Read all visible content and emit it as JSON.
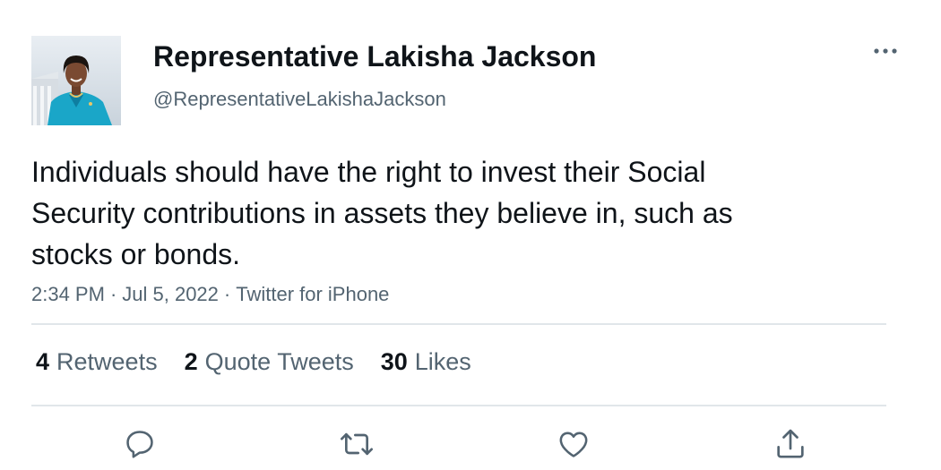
{
  "author": {
    "display_name": "Representative Lakisha Jackson",
    "handle": "@RepresentativeLakishaJackson",
    "avatar_icon": "profile-photo"
  },
  "tweet": {
    "text": "Individuals should have the right to invest their Social Security contributions in assets they believe in, such as stocks or bonds.",
    "time": "2:34 PM",
    "date": "Jul 5, 2022",
    "source": "Twitter for iPhone",
    "separator": "·"
  },
  "stats": {
    "retweets_count": "4",
    "retweets_label": "Retweets",
    "quotes_count": "2",
    "quotes_label": "Quote Tweets",
    "likes_count": "30",
    "likes_label": "Likes"
  },
  "actions": {
    "reply_icon": "reply-icon",
    "retweet_icon": "retweet-icon",
    "like_icon": "heart-icon",
    "share_icon": "share-icon",
    "more_icon": "more-icon"
  },
  "colors": {
    "text": "#0f1419",
    "secondary": "#536471",
    "divider": "#e1e6ea"
  }
}
